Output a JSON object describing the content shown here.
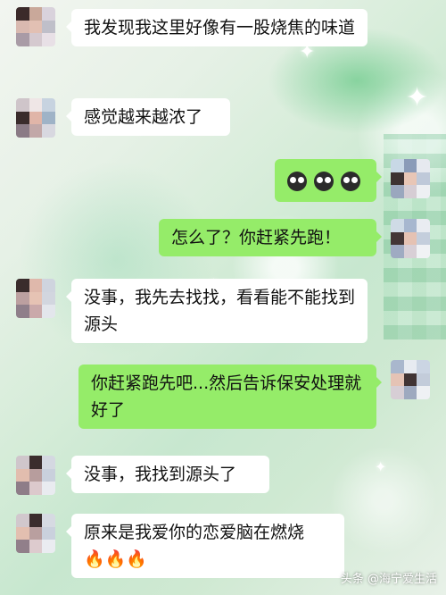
{
  "messages": [
    {
      "side": "in",
      "text": "我发现我这里好像有一股烧焦的味道"
    },
    {
      "side": "in",
      "text": "感觉越来越浓了"
    },
    {
      "side": "out",
      "emoji": [
        "face-icon",
        "face-icon",
        "face-icon"
      ]
    },
    {
      "side": "out",
      "text": "怎么了？你赶紧先跑！"
    },
    {
      "side": "in",
      "text": "没事，我先去找找，看看能不能找到源头"
    },
    {
      "side": "out",
      "text": "你赶紧跑先吧...然后告诉保安处理就好了"
    },
    {
      "side": "in",
      "text": "没事，我找到源头了"
    },
    {
      "side": "in",
      "text": "原来是我爱你的恋爱脑在燃烧",
      "suffix": "🔥🔥🔥"
    }
  ],
  "watermark": "头条 @海宁爱生活",
  "colors": {
    "outgoing_bubble": "#95ec69",
    "incoming_bubble": "#ffffff"
  }
}
